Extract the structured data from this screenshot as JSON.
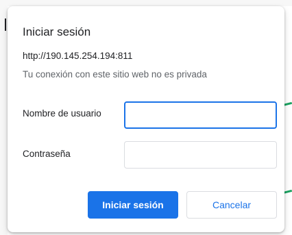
{
  "dialog": {
    "title": "Iniciar sesión",
    "origin_url": "http://190.145.254.194:811",
    "privacy_note": "Tu conexión con este sitio web no es privada"
  },
  "fields": {
    "username": {
      "label": "Nombre de usuario",
      "value": "",
      "placeholder": ""
    },
    "password": {
      "label": "Contraseña",
      "value": "",
      "placeholder": ""
    }
  },
  "buttons": {
    "sign_in_label": "Iniciar sesión",
    "cancel_label": "Cancelar"
  },
  "colors": {
    "accent": "#1a73e8",
    "green_marker": "#1aa260"
  }
}
